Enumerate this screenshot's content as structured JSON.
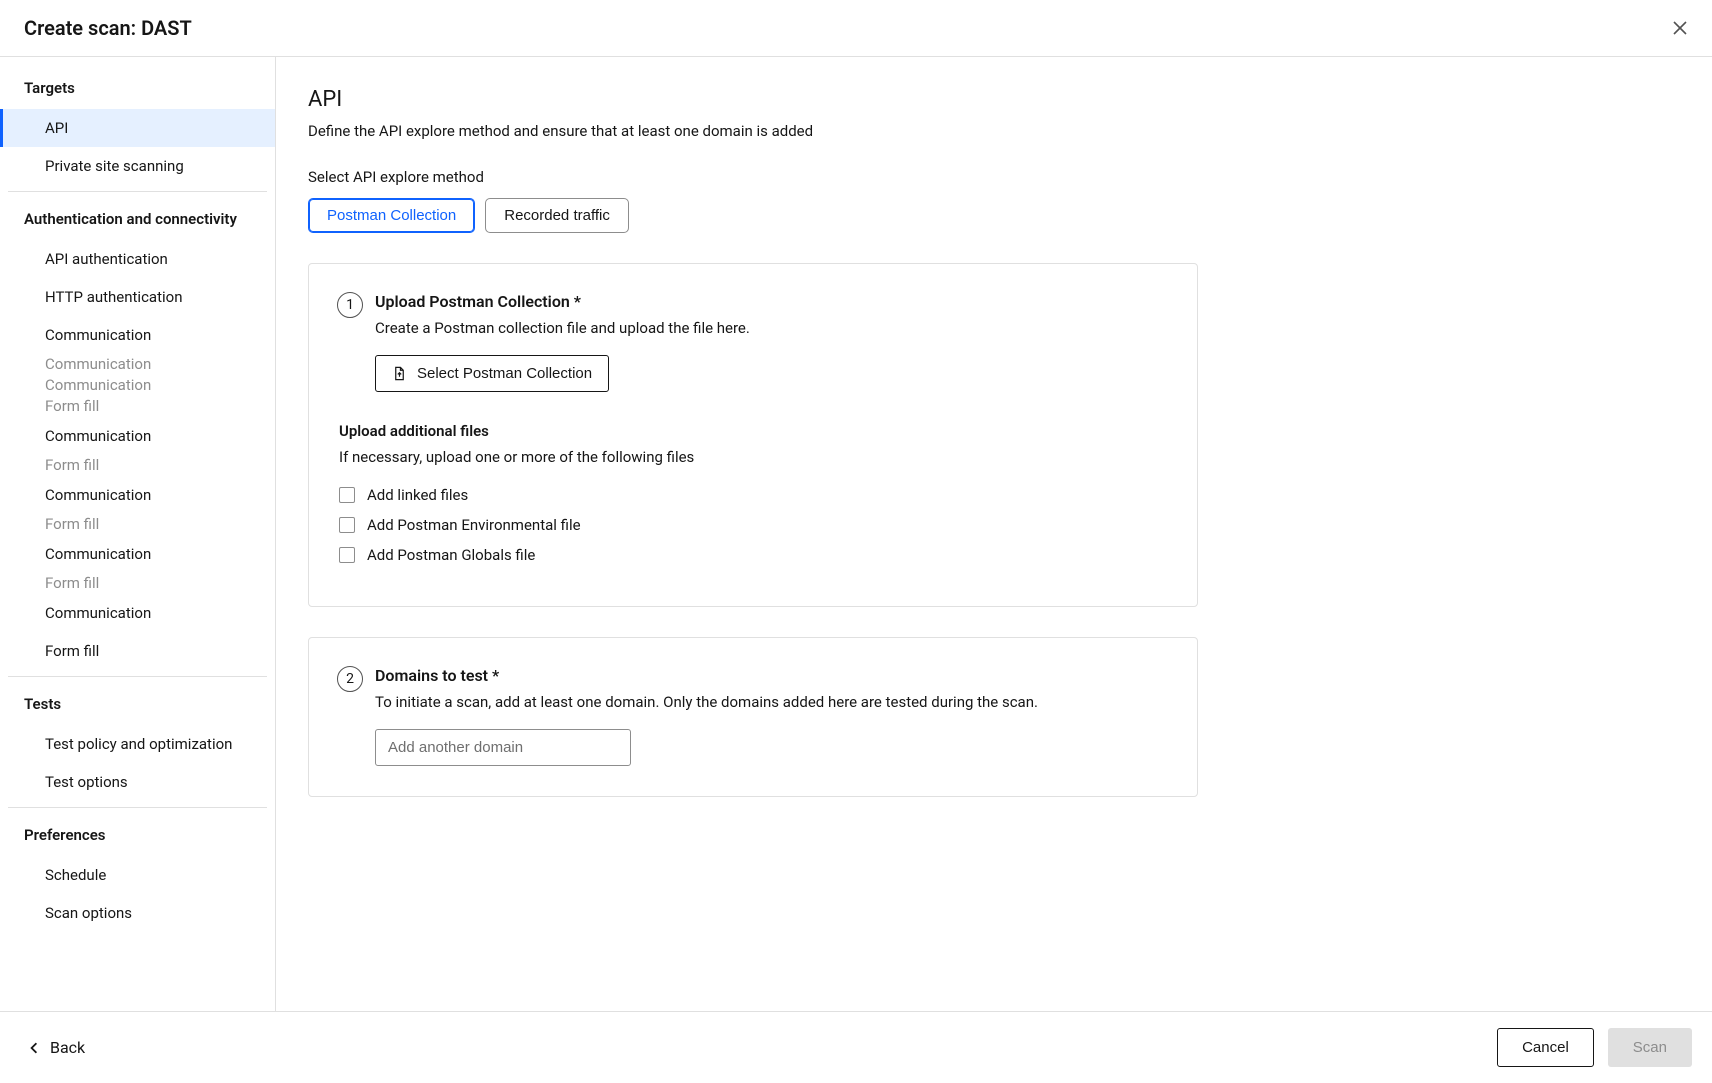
{
  "header": {
    "title": "Create scan: DAST"
  },
  "sidebar": {
    "groups": [
      {
        "title": "Targets",
        "items": [
          {
            "label": "API",
            "active": true
          },
          {
            "label": "Private site scanning",
            "active": false
          }
        ]
      },
      {
        "title": "Authentication and connectivity",
        "items": [
          {
            "label": "API authentication"
          },
          {
            "label": "HTTP authentication"
          },
          {
            "label": "Communication"
          },
          {
            "label": "Communication",
            "trunc": true
          },
          {
            "label": "Communication",
            "trunc": true
          },
          {
            "label": "Form fill",
            "trunc": true
          },
          {
            "label": "Communication"
          },
          {
            "label": "Form fill",
            "trunc": true
          },
          {
            "label": "Communication"
          },
          {
            "label": "Form fill",
            "trunc": true
          },
          {
            "label": "Communication"
          },
          {
            "label": "Form fill",
            "trunc": true
          },
          {
            "label": "Communication"
          },
          {
            "label": "Form fill"
          }
        ]
      },
      {
        "title": "Tests",
        "items": [
          {
            "label": "Test policy and optimization"
          },
          {
            "label": "Test options"
          }
        ]
      },
      {
        "title": "Preferences",
        "items": [
          {
            "label": "Schedule"
          },
          {
            "label": "Scan options"
          }
        ]
      }
    ]
  },
  "main": {
    "title": "API",
    "description": "Define the API explore method and ensure that at least one domain is added",
    "explore_label": "Select API explore method",
    "segments": [
      {
        "label": "Postman Collection",
        "selected": true
      },
      {
        "label": "Recorded traffic",
        "selected": false
      }
    ],
    "step1": {
      "num": "1",
      "title": "Upload Postman Collection *",
      "desc": "Create a Postman collection file and upload the file here.",
      "button_label": "Select Postman Collection",
      "additional_heading": "Upload additional files",
      "additional_desc": "If necessary, upload one or more of the following files",
      "options": [
        {
          "label": "Add linked files"
        },
        {
          "label": "Add Postman Environmental file"
        },
        {
          "label": "Add Postman Globals file"
        }
      ]
    },
    "step2": {
      "num": "2",
      "title": "Domains to test *",
      "desc": "To initiate a scan, add at least one domain. Only the domains added here are tested during the scan.",
      "placeholder": "Add another domain"
    }
  },
  "footer": {
    "back": "Back",
    "cancel": "Cancel",
    "scan": "Scan"
  }
}
